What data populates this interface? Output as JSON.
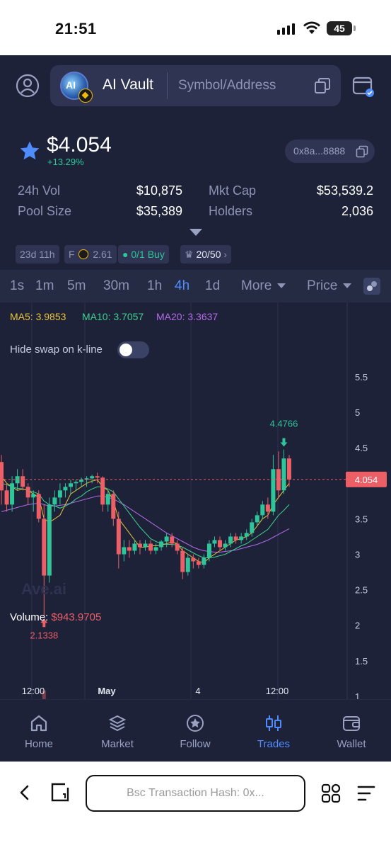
{
  "status_bar": {
    "time": "21:51",
    "battery": "45"
  },
  "header": {
    "token_name": "AI Vault",
    "logo_text": "AI",
    "search_placeholder": "Symbol/Address"
  },
  "price": {
    "value": "$4.054",
    "change": "+13.29%",
    "address": "0x8a...8888"
  },
  "stats": [
    {
      "label": "24h Vol",
      "value": "$10,875"
    },
    {
      "label": "Mkt Cap",
      "value": "$53,539.2"
    },
    {
      "label": "Pool Size",
      "value": "$35,389"
    },
    {
      "label": "Holders",
      "value": "2,036"
    }
  ],
  "chips": {
    "age": "23d 11h",
    "f_label": "F",
    "f_value": "2.61",
    "buy_prefix": "0/1",
    "buy_label": "Buy",
    "rank": "20/50"
  },
  "timeframes": [
    "1s",
    "1m",
    "5m",
    "30m",
    "1h",
    "4h",
    "1d"
  ],
  "active_timeframe": "4h",
  "more_label": "More",
  "price_label": "Price",
  "chart": {
    "ma5": "MA5: 3.9853",
    "ma10": "MA10: 3.7057",
    "ma20": "MA20: 3.3637",
    "hide_swap_label": "Hide swap on k-line",
    "hide_swap_on": false,
    "volume_label": "Volume:",
    "volume_value": "$943.9705",
    "watermark": "Ave.ai",
    "current_price_tag": "4.054",
    "high_marker": "4.4766",
    "low_marker": "2.1338",
    "colors": {
      "up": "#2fc59a",
      "down": "#ec5f66",
      "ma5": "#e8c43a",
      "ma10": "#3fd18f",
      "ma20": "#b56be8"
    }
  },
  "chart_data": {
    "type": "candlestick",
    "y_ticks": [
      "5.5",
      "5",
      "4.5",
      "4",
      "3.5",
      "3",
      "2.5",
      "2",
      "1.5",
      "1"
    ],
    "ylim": [
      0.5,
      5.8
    ],
    "x_ticks": [
      "12:00",
      "May",
      "4",
      "12:00"
    ],
    "candles": [
      [
        4.3,
        4.4,
        3.7,
        3.9
      ],
      [
        3.9,
        4.0,
        3.6,
        3.7
      ],
      [
        3.7,
        4.1,
        3.6,
        4.0
      ],
      [
        4.0,
        4.2,
        3.9,
        4.1
      ],
      [
        4.1,
        4.2,
        3.9,
        3.95
      ],
      [
        3.95,
        4.0,
        3.7,
        3.8
      ],
      [
        3.8,
        3.9,
        3.6,
        3.85
      ],
      [
        3.85,
        3.9,
        3.45,
        3.5
      ],
      [
        3.5,
        3.7,
        2.13,
        2.7
      ],
      [
        2.7,
        3.8,
        2.6,
        3.7
      ],
      [
        3.7,
        3.9,
        3.6,
        3.8
      ],
      [
        3.8,
        4.0,
        3.7,
        3.9
      ],
      [
        3.9,
        4.0,
        3.8,
        3.95
      ],
      [
        3.95,
        4.05,
        3.85,
        4.0
      ],
      [
        4.0,
        4.05,
        3.9,
        4.02
      ],
      [
        4.02,
        4.08,
        3.95,
        4.05
      ],
      [
        4.05,
        4.1,
        3.95,
        4.07
      ],
      [
        4.07,
        4.12,
        4.0,
        4.1
      ],
      [
        4.1,
        4.15,
        4.0,
        4.08
      ],
      [
        4.08,
        4.1,
        3.6,
        3.7
      ],
      [
        3.7,
        3.9,
        3.6,
        3.85
      ],
      [
        3.85,
        3.9,
        3.4,
        3.5
      ],
      [
        3.5,
        3.6,
        2.8,
        3.0
      ],
      [
        3.0,
        3.2,
        2.9,
        3.1
      ],
      [
        3.1,
        3.2,
        2.95,
        3.05
      ],
      [
        3.05,
        3.2,
        3.0,
        3.15
      ],
      [
        3.15,
        3.2,
        3.0,
        3.1
      ],
      [
        3.1,
        3.2,
        3.05,
        3.15
      ],
      [
        3.15,
        3.2,
        3.0,
        3.05
      ],
      [
        3.05,
        3.15,
        3.0,
        3.1
      ],
      [
        3.1,
        3.2,
        3.05,
        3.18
      ],
      [
        3.18,
        3.3,
        3.1,
        3.25
      ],
      [
        3.25,
        3.3,
        3.1,
        3.15
      ],
      [
        3.15,
        3.2,
        3.0,
        3.05
      ],
      [
        3.05,
        3.1,
        2.65,
        2.75
      ],
      [
        2.75,
        3.0,
        2.7,
        2.95
      ],
      [
        2.95,
        3.0,
        2.8,
        2.9
      ],
      [
        2.9,
        2.95,
        2.8,
        2.85
      ],
      [
        2.85,
        3.0,
        2.8,
        2.95
      ],
      [
        2.95,
        3.2,
        2.9,
        3.15
      ],
      [
        3.15,
        3.25,
        3.1,
        3.2
      ],
      [
        3.2,
        3.25,
        3.05,
        3.1
      ],
      [
        3.1,
        3.2,
        3.05,
        3.15
      ],
      [
        3.15,
        3.3,
        3.1,
        3.25
      ],
      [
        3.25,
        3.3,
        3.15,
        3.2
      ],
      [
        3.2,
        3.3,
        3.15,
        3.25
      ],
      [
        3.25,
        3.35,
        3.2,
        3.3
      ],
      [
        3.3,
        3.5,
        3.25,
        3.45
      ],
      [
        3.45,
        3.6,
        3.4,
        3.55
      ],
      [
        3.55,
        3.75,
        3.5,
        3.7
      ],
      [
        3.7,
        3.8,
        3.5,
        3.6
      ],
      [
        3.6,
        4.4,
        3.55,
        4.2
      ],
      [
        4.2,
        4.45,
        3.8,
        3.9
      ],
      [
        3.9,
        4.4766,
        3.85,
        4.35
      ],
      [
        4.35,
        4.4,
        3.95,
        4.054
      ]
    ],
    "ma5": [
      4.1,
      4.0,
      3.95,
      3.9,
      3.92,
      3.9,
      3.85,
      3.8,
      3.5,
      3.45,
      3.5,
      3.55,
      3.7,
      3.85,
      3.9,
      3.95,
      4.0,
      4.03,
      4.05,
      3.95,
      3.9,
      3.75,
      3.5,
      3.4,
      3.3,
      3.2,
      3.1,
      3.1,
      3.12,
      3.12,
      3.13,
      3.15,
      3.17,
      3.15,
      3.05,
      3.0,
      2.95,
      2.9,
      2.88,
      2.95,
      3.0,
      3.05,
      3.1,
      3.15,
      3.2,
      3.22,
      3.25,
      3.3,
      3.4,
      3.5,
      3.55,
      3.7,
      3.8,
      3.9,
      4.0
    ],
    "ma10": [
      4.0,
      3.98,
      3.95,
      3.93,
      3.92,
      3.9,
      3.88,
      3.85,
      3.75,
      3.7,
      3.68,
      3.65,
      3.68,
      3.72,
      3.78,
      3.82,
      3.88,
      3.92,
      3.95,
      3.95,
      3.92,
      3.88,
      3.78,
      3.68,
      3.58,
      3.48,
      3.38,
      3.3,
      3.22,
      3.18,
      3.15,
      3.14,
      3.14,
      3.13,
      3.1,
      3.06,
      3.02,
      2.98,
      2.95,
      2.95,
      2.96,
      2.98,
      3.0,
      3.04,
      3.08,
      3.12,
      3.15,
      3.2,
      3.25,
      3.3,
      3.35,
      3.45,
      3.55,
      3.62,
      3.7
    ],
    "ma20": [
      3.6,
      3.62,
      3.64,
      3.66,
      3.68,
      3.7,
      3.71,
      3.72,
      3.7,
      3.68,
      3.68,
      3.69,
      3.7,
      3.72,
      3.74,
      3.76,
      3.78,
      3.8,
      3.82,
      3.82,
      3.8,
      3.78,
      3.74,
      3.7,
      3.65,
      3.6,
      3.55,
      3.5,
      3.45,
      3.4,
      3.35,
      3.3,
      3.26,
      3.22,
      3.18,
      3.14,
      3.1,
      3.07,
      3.05,
      3.04,
      3.03,
      3.03,
      3.04,
      3.05,
      3.06,
      3.08,
      3.1,
      3.12,
      3.14,
      3.17,
      3.2,
      3.24,
      3.28,
      3.32,
      3.36
    ],
    "volume": [
      0.03,
      0.02,
      0.025,
      0.02,
      0.015,
      0.02,
      0.02,
      0.045,
      0.5,
      0.06,
      0.02,
      0.015,
      0.015,
      0.012,
      0.01,
      0.012,
      0.01,
      0.012,
      0.01,
      0.035,
      0.02,
      0.03,
      0.05,
      0.02,
      0.015,
      0.012,
      0.015,
      0.01,
      0.012,
      0.01,
      0.04,
      0.02,
      0.015,
      0.015,
      0.03,
      0.015,
      0.012,
      0.01,
      0.012,
      0.015,
      0.01,
      0.012,
      0.01,
      0.012,
      0.015,
      0.012,
      0.015,
      0.02,
      0.02,
      0.03,
      0.02,
      0.07,
      0.04,
      0.03,
      0.02
    ]
  },
  "nav": [
    {
      "label": "Home",
      "icon": "home-icon"
    },
    {
      "label": "Market",
      "icon": "layers-icon"
    },
    {
      "label": "Follow",
      "icon": "star-icon"
    },
    {
      "label": "Trades",
      "icon": "candles-icon"
    },
    {
      "label": "Wallet",
      "icon": "wallet-icon"
    }
  ],
  "active_nav": "Trades",
  "browser": {
    "url_text": "Bsc Transaction Hash: 0x..."
  }
}
